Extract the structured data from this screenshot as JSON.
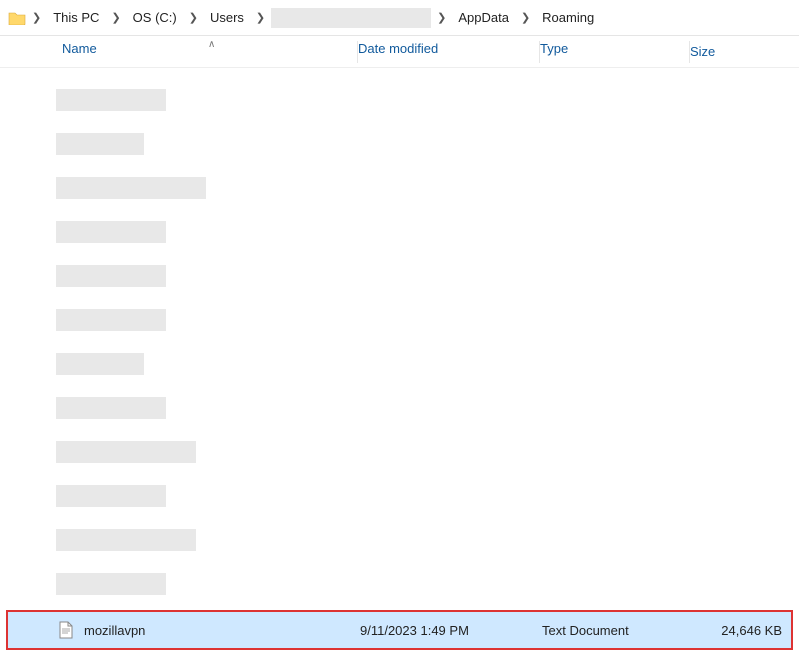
{
  "breadcrumb": {
    "items": [
      "This PC",
      "OS (C:)",
      "Users",
      "",
      "AppData",
      "Roaming"
    ]
  },
  "columns": {
    "name": "Name",
    "date": "Date modified",
    "type": "Type",
    "size": "Size"
  },
  "redacted_rows": [
    {
      "name_w": 110,
      "date_w": 110,
      "type_w": 100
    },
    {
      "name_w": 88,
      "date_w": 110,
      "type_w": 46
    },
    {
      "name_w": 150,
      "date_w": 110,
      "type_w": 100
    },
    {
      "name_w": 110,
      "date_w": 110,
      "type_w": 100
    },
    {
      "name_w": 110,
      "date_w": 110,
      "type_w": 100
    },
    {
      "name_w": 110,
      "date_w": 110,
      "type_w": 100
    },
    {
      "name_w": 88,
      "date_w": 110,
      "type_w": 100,
      "type_off": -6
    },
    {
      "name_w": 110,
      "date_w": 110,
      "type_w": 0
    },
    {
      "name_w": 140,
      "date_w": 110,
      "type_w": 140
    },
    {
      "name_w": 110,
      "date_w": 110,
      "type_w": 0
    },
    {
      "name_w": 140,
      "date_w": 110,
      "type_w": 140
    },
    {
      "name_w": 110,
      "date_w": 110,
      "type_w": 0
    }
  ],
  "file": {
    "name": "mozillavpn",
    "date": "9/11/2023 1:49 PM",
    "type": "Text Document",
    "size": "24,646 KB"
  }
}
